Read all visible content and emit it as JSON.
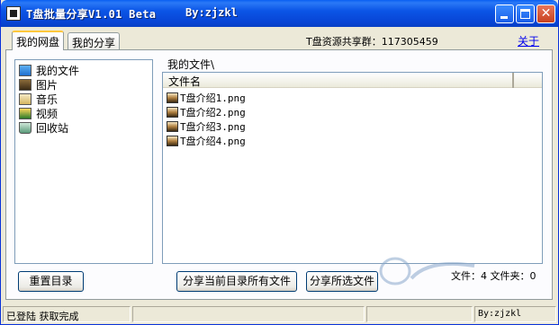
{
  "window": {
    "title": "T盘批量分享V1.01 Beta",
    "author": "By:zjzkl",
    "min_glyph": "",
    "max_glyph": "",
    "close_glyph": "✕"
  },
  "tabs": [
    {
      "label": "我的网盘",
      "active": true
    },
    {
      "label": "我的分享",
      "active": false
    }
  ],
  "header": {
    "group_text": "T盘资源共享群：117305459",
    "about_label": "关于"
  },
  "tree": {
    "items": [
      {
        "label": "我的文件",
        "icon": "folder-files-icon"
      },
      {
        "label": "图片",
        "icon": "pictures-icon"
      },
      {
        "label": "音乐",
        "icon": "music-icon"
      },
      {
        "label": "视频",
        "icon": "video-icon"
      },
      {
        "label": "回收站",
        "icon": "recycle-bin-icon"
      }
    ]
  },
  "file_panel": {
    "path": "我的文件\\",
    "column_header": "文件名",
    "files": [
      "T盘介绍1.png",
      "T盘介绍2.png",
      "T盘介绍3.png",
      "T盘介绍4.png"
    ]
  },
  "buttons": {
    "reset": "重置目录",
    "share_all": "分享当前目录所有文件",
    "share_selected": "分享所选文件"
  },
  "counts": "文件：4 文件夹：0",
  "statusbar": {
    "login": "已登陆",
    "status": "获取完成",
    "cell2": "",
    "cell3": "",
    "author": "By:zjzkl"
  },
  "colors": {
    "titlebar": "#0845D6",
    "window_bg": "#ECE9D8",
    "link": "#0000EE"
  }
}
